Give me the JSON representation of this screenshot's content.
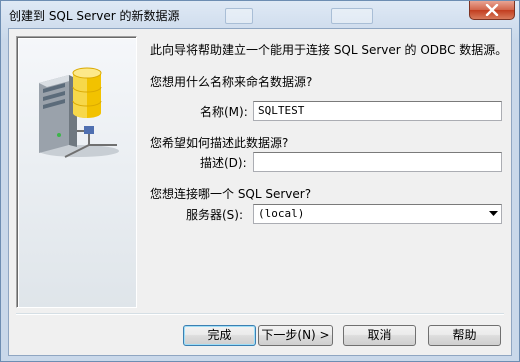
{
  "window": {
    "title": "创建到 SQL Server 的新数据源"
  },
  "intro": "此向导将帮助建立一个能用于连接 SQL Server 的 ODBC 数据源。",
  "name_section": {
    "question": "您想用什么名称来命名数据源?",
    "label": "名称(M):",
    "value": "SQLTEST"
  },
  "description_section": {
    "question": "您希望如何描述此数据源?",
    "label": "描述(D):",
    "value": ""
  },
  "server_section": {
    "question": "您想连接哪一个 SQL Server?",
    "label": "服务器(S):",
    "value": "(local)"
  },
  "buttons": {
    "finish": "完成",
    "next": "下一步(N) >",
    "cancel": "取消",
    "help": "帮助"
  },
  "icons": {
    "close": "close-icon",
    "illustration": "database-server-icon",
    "dropdown": "chevron-down-icon"
  },
  "colors": {
    "close_button": "#c94a2e",
    "default_button_border": "#3c7fb1",
    "database_cylinder": "#f2c200"
  }
}
